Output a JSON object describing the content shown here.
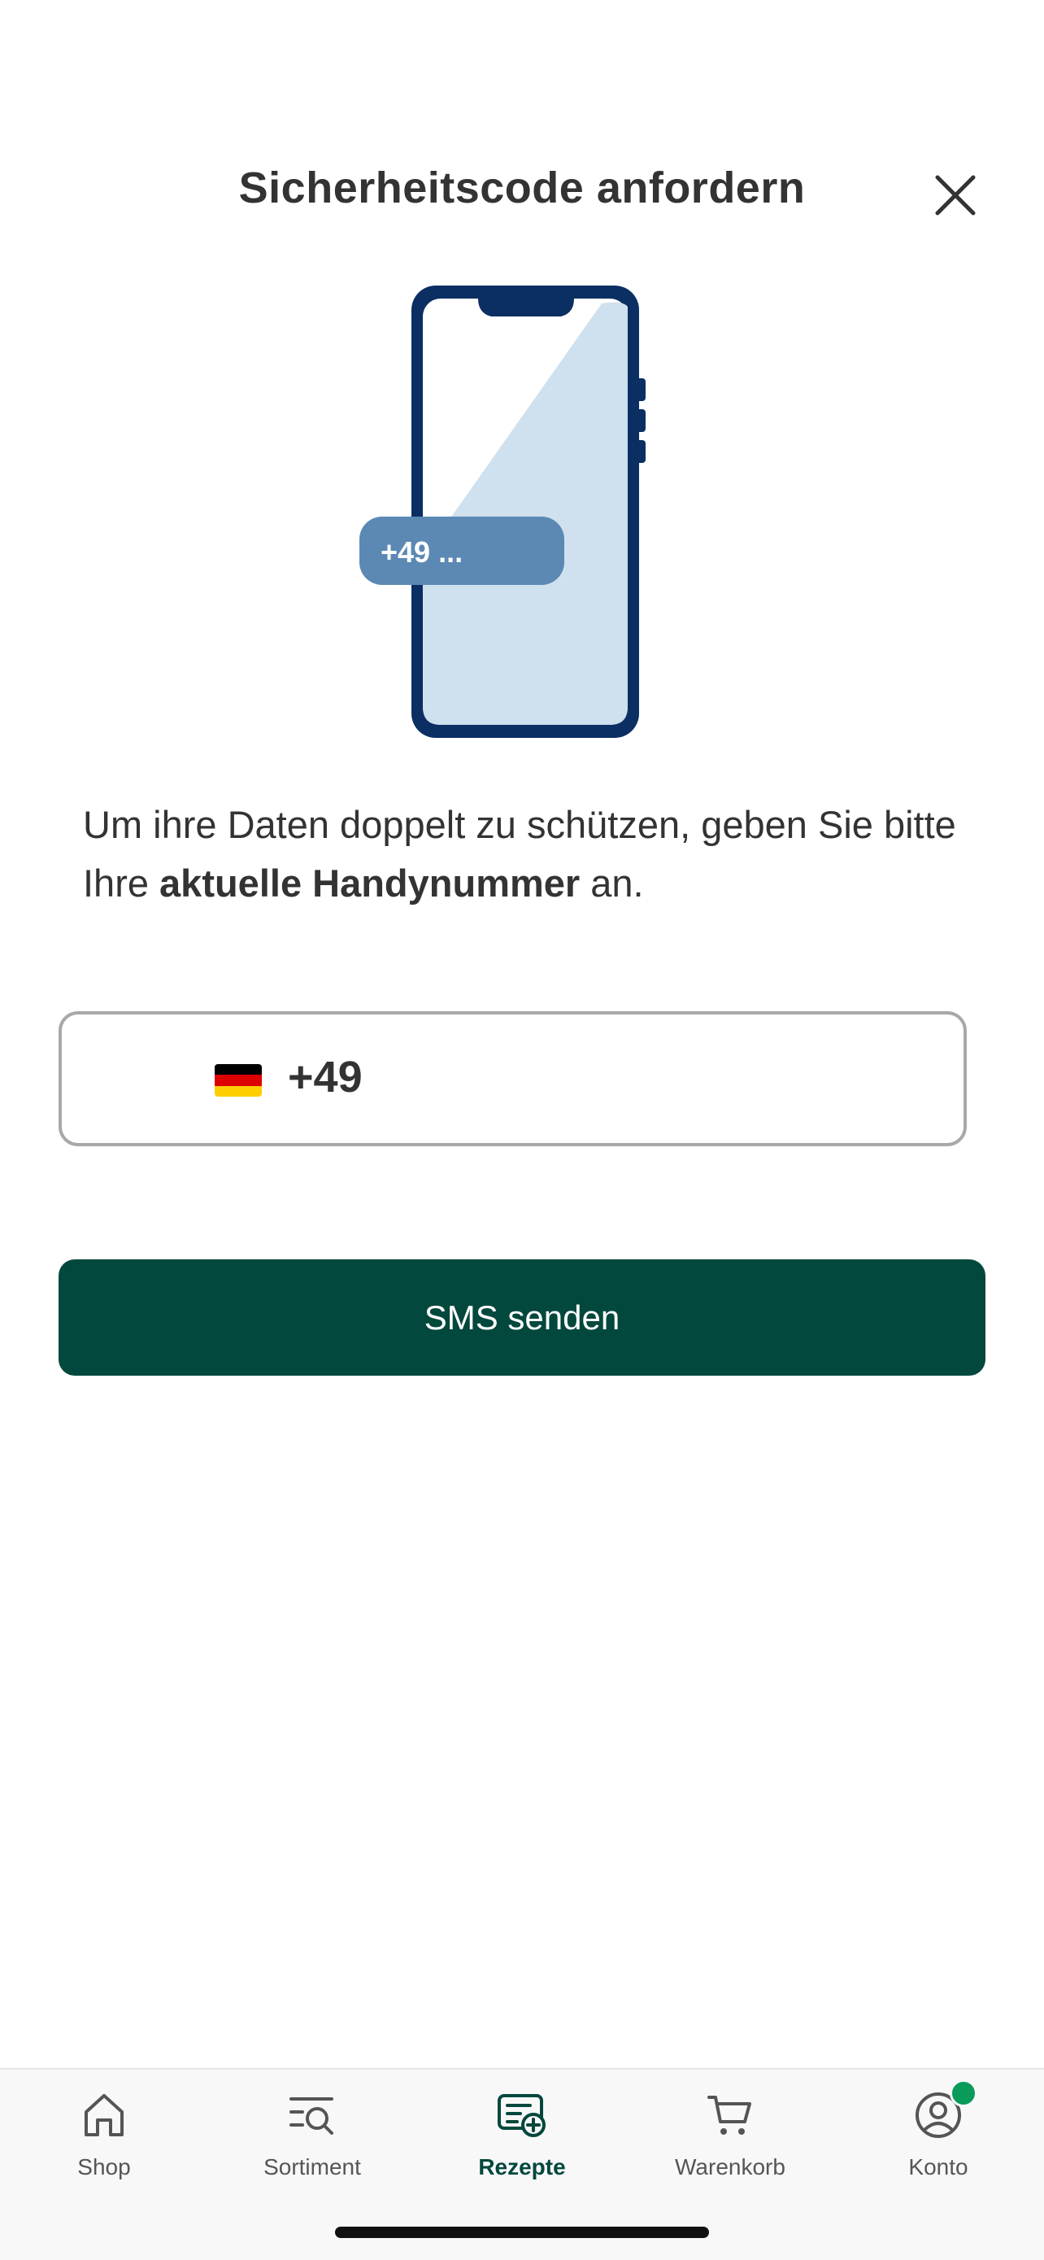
{
  "modal": {
    "title": "Sicherheitscode anfordern",
    "illustration_badge": "+49 ...",
    "intro_text_before": "Um ihre Daten doppelt zu schützen, geben Sie bitte Ihre ",
    "intro_text_bold": "aktuelle Handynummer",
    "intro_text_after": " an.",
    "phone": {
      "country_code": "+49",
      "value": "",
      "placeholder": ""
    },
    "submit_label": "SMS senden"
  },
  "tabbar": {
    "items": [
      {
        "label": "Shop",
        "icon": "home-icon",
        "active": false
      },
      {
        "label": "Sortiment",
        "icon": "catalog-search-icon",
        "active": false
      },
      {
        "label": "Rezepte",
        "icon": "prescription-icon",
        "active": true
      },
      {
        "label": "Warenkorb",
        "icon": "cart-icon",
        "active": false
      },
      {
        "label": "Konto",
        "icon": "account-icon",
        "active": false,
        "badge": true
      }
    ]
  },
  "colors": {
    "primary": "#03483d",
    "badge": "#0a9a5a",
    "phone_frame": "#0b2e63",
    "phone_screen": "#cfe0ee",
    "phone_chip": "#5b89b4"
  }
}
